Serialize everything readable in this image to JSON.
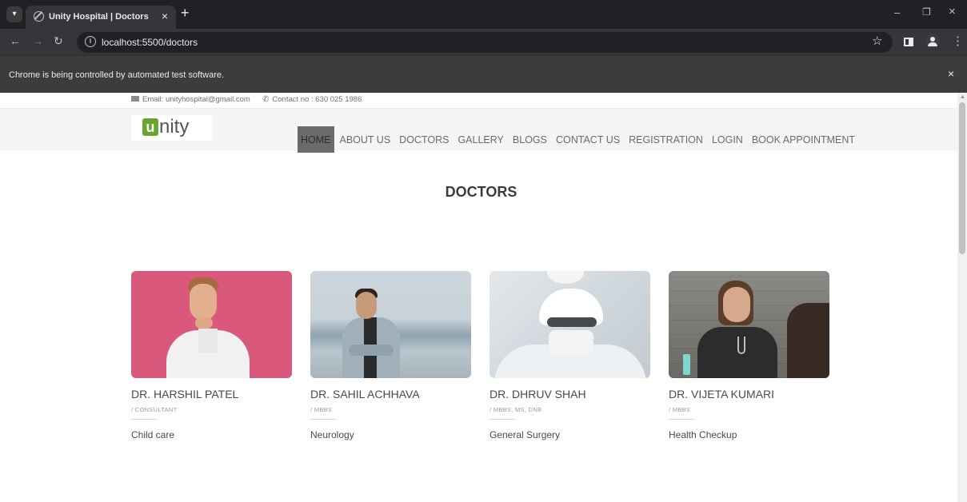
{
  "browser": {
    "tab_title": "Unity Hospital | Doctors",
    "tab_close": "×",
    "new_tab": "+",
    "url": "localhost:5500/doctors",
    "infobar_text": "Chrome is being controlled by automated test software.",
    "infobar_close": "×",
    "window_controls": {
      "minimize": "–",
      "restore": "❐",
      "close": "×"
    }
  },
  "topbar": {
    "email": "Email: unityhospital@gmail.com",
    "phone": "Contact no : 630 025 1986"
  },
  "header": {
    "logo_mark": "u",
    "logo_text": "nity",
    "nav": [
      {
        "label": "HOME",
        "active": true
      },
      {
        "label": "ABOUT US"
      },
      {
        "label": "DOCTORS"
      },
      {
        "label": "GALLERY"
      },
      {
        "label": "BLOGS"
      },
      {
        "label": "CONTACT US"
      },
      {
        "label": "REGISTRATION"
      },
      {
        "label": "LOGIN"
      },
      {
        "label": "BOOK APPOINTMENT"
      }
    ]
  },
  "main": {
    "title": "DOCTORS",
    "doctors": [
      {
        "name": "DR. HARSHIL PATEL",
        "degree": "/ CONSULTANT",
        "specialty": "Child care"
      },
      {
        "name": "DR. SAHIL ACHHAVA",
        "degree": "/ MBBS",
        "specialty": "Neurology"
      },
      {
        "name": "DR. DHRUV SHAH",
        "degree": "/ MBBS, MS, DNB",
        "specialty": "General Surgery"
      },
      {
        "name": "DR. VIJETA KUMARI",
        "degree": "/ MBBS",
        "specialty": "Health Checkup"
      }
    ]
  }
}
